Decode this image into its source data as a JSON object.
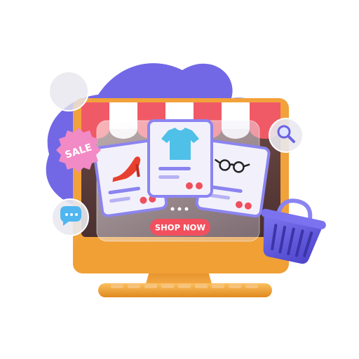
{
  "badge": {
    "sale_label": "SALE"
  },
  "cta": {
    "shop_now_label": "SHOP NOW"
  },
  "products": [
    {
      "name": "shoe",
      "icon": "high-heel-shoe-icon"
    },
    {
      "name": "shirt",
      "icon": "t-shirt-icon"
    },
    {
      "name": "glasses",
      "icon": "eyeglasses-icon"
    }
  ],
  "colors": {
    "blob": "#7268e6",
    "monitor": "#f2a23a",
    "monitor_dark": "#d9861e",
    "awning_red": "#f05a66",
    "screen": "#5a3b3a",
    "card": "#f2f1fb",
    "card_border": "#8b84f0",
    "sale_pink": "#f28ac6",
    "basket": "#6259e0",
    "heart_red": "#f0505d",
    "shop_button": "#f2505e",
    "shirt_blue": "#4fc0e8"
  }
}
